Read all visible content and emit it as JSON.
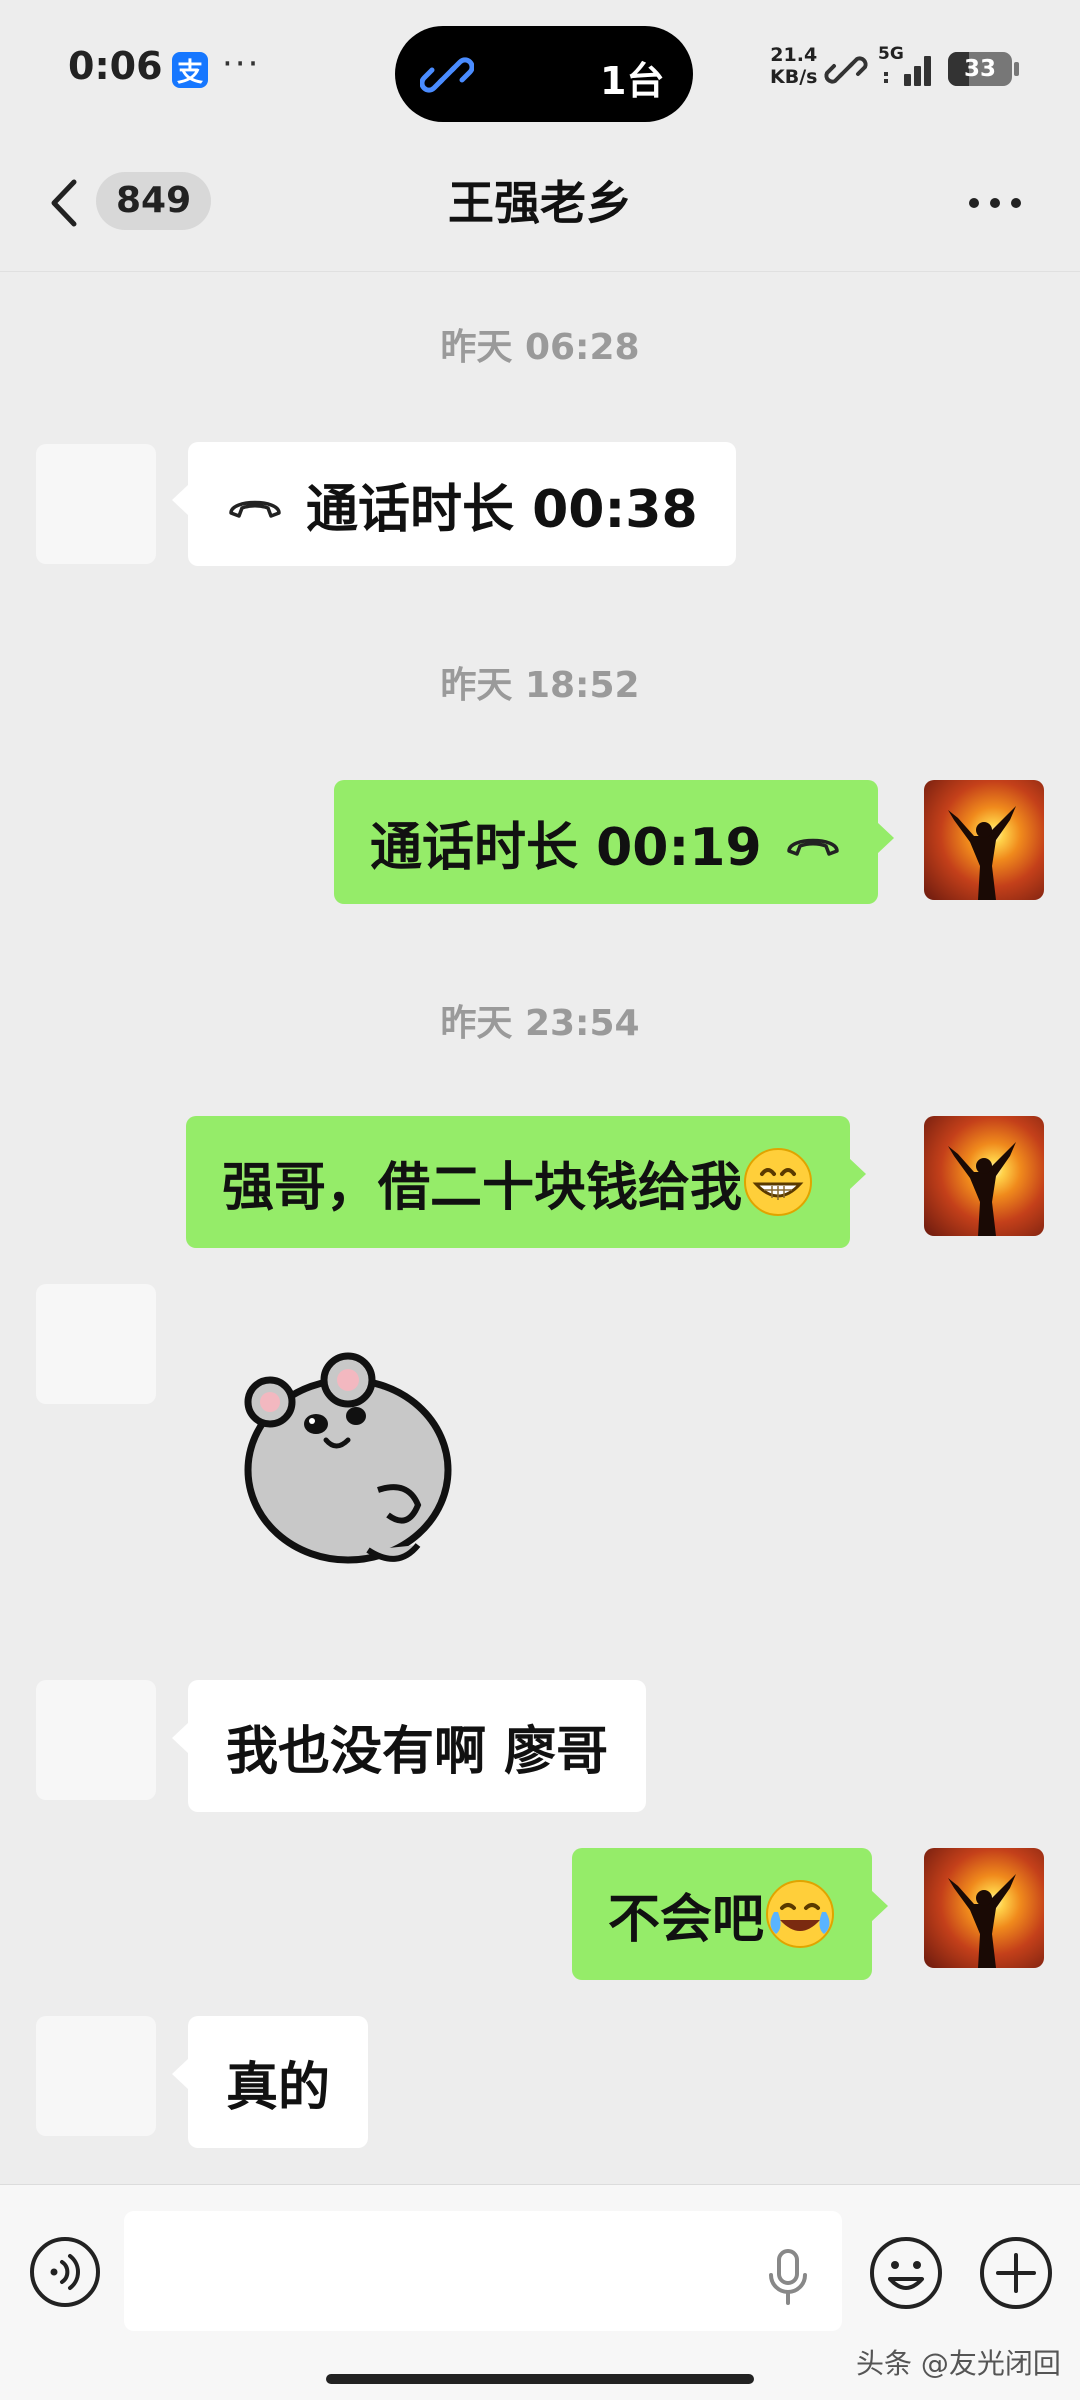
{
  "status_bar": {
    "time": "0:06",
    "alipay_icon_text": "支",
    "more_dots": "···",
    "island_text": "1台",
    "speed_value": "21.4",
    "speed_unit": "KB/s",
    "network": "5G",
    "battery": "33",
    "battery_level": 0.33
  },
  "nav": {
    "badge": "849",
    "title": "王强老乡"
  },
  "messages": [
    {
      "kind": "timestamp",
      "text": "昨天 06:28"
    },
    {
      "kind": "call",
      "side": "in",
      "text": "通话时长 00:38"
    },
    {
      "kind": "timestamp",
      "text": "昨天 18:52"
    },
    {
      "kind": "call",
      "side": "out",
      "text": "通话时长 00:19"
    },
    {
      "kind": "timestamp",
      "text": "昨天 23:54"
    },
    {
      "kind": "text",
      "side": "out",
      "text": "强哥，借二十块钱给我",
      "emoji": "grin-icon"
    },
    {
      "kind": "sticker",
      "side": "in",
      "sticker": "gray-hamster-sticker"
    },
    {
      "kind": "text",
      "side": "in",
      "text": "我也没有啊 廖哥"
    },
    {
      "kind": "text",
      "side": "out",
      "text": "不会吧",
      "emoji": "crying-laughing-icon"
    },
    {
      "kind": "text",
      "side": "in",
      "text": "真的"
    }
  ],
  "input_bar": {
    "placeholder": ""
  },
  "watermark": "头条 @友光闭回",
  "colors": {
    "background": "#ededed",
    "outgoing_bubble": "#95ec69",
    "incoming_bubble": "#ffffff",
    "timestamp_text": "#9a9a9a"
  }
}
